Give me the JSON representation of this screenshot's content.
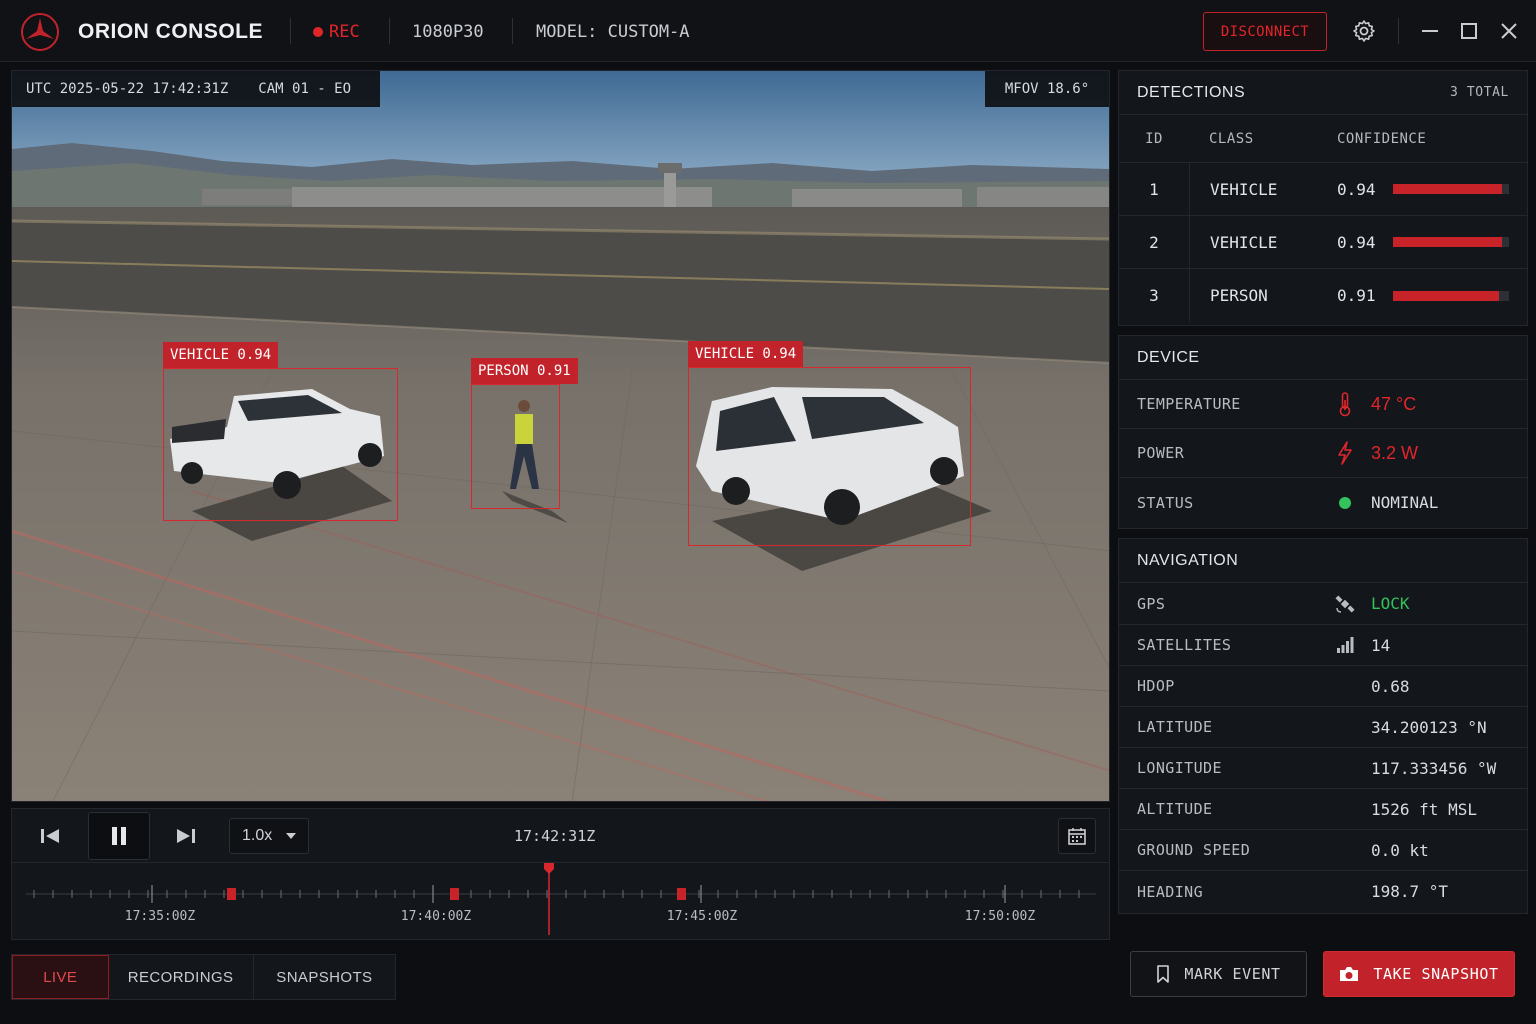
{
  "app": {
    "title": "ORION CONSOLE",
    "rec_label": "REC",
    "resolution": "1080P30",
    "model": "MODEL: CUSTOM-A",
    "disconnect_label": "DISCONNECT"
  },
  "video": {
    "utc": "UTC 2025-05-22 17:42:31Z",
    "camera": "CAM 01 - EO",
    "fov": "MFOV 18.6°",
    "overlays": [
      {
        "label": "VEHICLE 0.94"
      },
      {
        "label": "PERSON 0.91"
      },
      {
        "label": "VEHICLE 0.94"
      }
    ]
  },
  "playback": {
    "speed": "1.0x",
    "current_time": "17:42:31Z",
    "timeline_labels": [
      "17:35:00Z",
      "17:40:00Z",
      "17:45:00Z",
      "17:50:00Z"
    ]
  },
  "tabs": [
    "LIVE",
    "RECORDINGS",
    "SNAPSHOTS"
  ],
  "detections": {
    "title": "DETECTIONS",
    "count": "3 TOTAL",
    "columns": [
      "ID",
      "CLASS",
      "CONFIDENCE"
    ],
    "rows": [
      {
        "id": "1",
        "class": "VEHICLE",
        "confidence": "0.94",
        "value": 0.94
      },
      {
        "id": "2",
        "class": "VEHICLE",
        "confidence": "0.94",
        "value": 0.94
      },
      {
        "id": "3",
        "class": "PERSON",
        "confidence": "0.91",
        "value": 0.91
      }
    ]
  },
  "device": {
    "title": "DEVICE",
    "temperature": {
      "label": "TEMPERATURE",
      "value": "47 °C",
      "icon": "thermometer-icon"
    },
    "power": {
      "label": "POWER",
      "value": "3.2 W",
      "icon": "lightning-icon"
    },
    "status": {
      "label": "STATUS",
      "value": "NOMINAL",
      "icon": "status-dot-icon"
    }
  },
  "navigation": {
    "title": "NAVIGATION",
    "rows": [
      {
        "label": "GPS",
        "value": "LOCK",
        "icon": "satellite-icon"
      },
      {
        "label": "SATELLITES",
        "value": "14",
        "icon": "signal-bars-icon"
      },
      {
        "label": "HDOP",
        "value": "0.68"
      },
      {
        "label": "LATITUDE",
        "value": "34.200123 °N"
      },
      {
        "label": "LONGITUDE",
        "value": "117.333456 °W"
      },
      {
        "label": "ALTITUDE",
        "value": "1526 ft MSL"
      },
      {
        "label": "GROUND SPEED",
        "value": "0.0 kt"
      },
      {
        "label": "HEADING",
        "value": "198.7 °T"
      }
    ]
  },
  "actions": {
    "mark_event": "MARK EVENT",
    "take_snapshot": "TAKE SNAPSHOT"
  },
  "colors": {
    "accent": "#c2232a",
    "ok": "#33c25b",
    "background": "#0c0e12"
  }
}
